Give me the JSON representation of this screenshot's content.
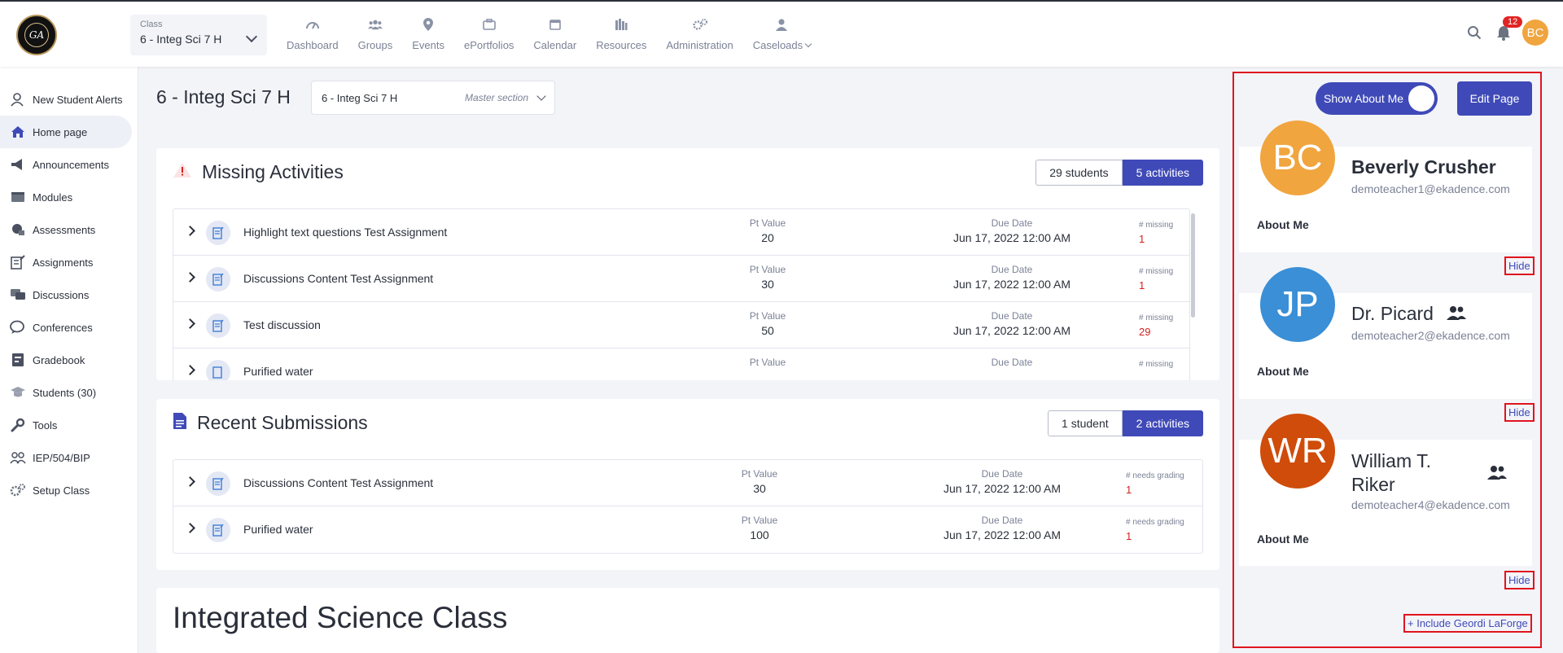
{
  "topbar": {
    "logo_text": "GA",
    "class_label": "Class",
    "class_value": "6 - Integ Sci 7 H",
    "nav": [
      {
        "label": "Dashboard",
        "icon": "gauge-icon"
      },
      {
        "label": "Groups",
        "icon": "groups-icon"
      },
      {
        "label": "Events",
        "icon": "map-pin-icon"
      },
      {
        "label": "ePortfolios",
        "icon": "briefcase-icon"
      },
      {
        "label": "Calendar",
        "icon": "calendar-icon"
      },
      {
        "label": "Resources",
        "icon": "books-icon"
      },
      {
        "label": "Administration",
        "icon": "gears-icon"
      },
      {
        "label": "Caseloads",
        "icon": "user-icon"
      }
    ],
    "notification_count": "12",
    "user_initials": "BC"
  },
  "sidebar": {
    "items": [
      {
        "label": "New Student Alerts",
        "icon": "user-alert-icon"
      },
      {
        "label": "Home page",
        "icon": "home-icon"
      },
      {
        "label": "Announcements",
        "icon": "megaphone-icon"
      },
      {
        "label": "Modules",
        "icon": "folder-icon"
      },
      {
        "label": "Assessments",
        "icon": "assessment-icon"
      },
      {
        "label": "Assignments",
        "icon": "assignment-icon"
      },
      {
        "label": "Discussions",
        "icon": "discussion-icon"
      },
      {
        "label": "Conferences",
        "icon": "chat-icon"
      },
      {
        "label": "Gradebook",
        "icon": "gradebook-icon"
      },
      {
        "label": "Students (30)",
        "icon": "students-icon"
      },
      {
        "label": "Tools",
        "icon": "wrench-icon"
      },
      {
        "label": "IEP/504/BIP",
        "icon": "people-icon"
      },
      {
        "label": "Setup Class",
        "icon": "gear-icon"
      }
    ]
  },
  "main": {
    "title": "6 - Integ Sci 7 H",
    "section_value": "6 - Integ Sci 7 H",
    "section_meta": "Master section",
    "missing": {
      "title": "Missing Activities",
      "toggle_students": "29 students",
      "toggle_activities": "5 activities",
      "pt_header": "Pt Value",
      "due_header": "Due Date",
      "count_header": "# missing",
      "rows": [
        {
          "name": "Highlight text questions Test Assignment",
          "pt": "20",
          "due": "Jun 17, 2022 12:00 AM",
          "count": "1"
        },
        {
          "name": "Discussions Content Test Assignment",
          "pt": "30",
          "due": "Jun 17, 2022 12:00 AM",
          "count": "1"
        },
        {
          "name": "Test discussion",
          "pt": "50",
          "due": "Jun 17, 2022 12:00 AM",
          "count": "29"
        },
        {
          "name": "Purified water",
          "pt": "",
          "due": "",
          "count": ""
        }
      ]
    },
    "recent": {
      "title": "Recent Submissions",
      "toggle_students": "1 student",
      "toggle_activities": "2 activities",
      "pt_header": "Pt Value",
      "due_header": "Due Date",
      "count_header": "# needs grading",
      "rows": [
        {
          "name": "Discussions Content Test Assignment",
          "pt": "30",
          "due": "Jun 17, 2022 12:00 AM",
          "count": "1"
        },
        {
          "name": "Purified water",
          "pt": "100",
          "due": "Jun 17, 2022 12:00 AM",
          "count": "1"
        }
      ]
    },
    "integrated_title": "Integrated Science Class"
  },
  "right": {
    "show_about_label": "Show About Me",
    "edit_page_label": "Edit Page",
    "teachers": [
      {
        "initials": "BC",
        "name": "Beverly Crusher",
        "email": "demoteacher1@ekadence.com",
        "about_label": "About Me",
        "hide_label": "Hide",
        "color": "#f0a53e"
      },
      {
        "initials": "JP",
        "name": "Dr. Picard",
        "email": "demoteacher2@ekadence.com",
        "about_label": "About Me",
        "hide_label": "Hide",
        "color": "#3a8fd6"
      },
      {
        "initials": "WR",
        "name_line1": "William T.",
        "name_line2": "Riker",
        "email": "demoteacher4@ekadence.com",
        "about_label": "About Me",
        "hide_label": "Hide",
        "color": "#cf4c0a"
      }
    ],
    "include_label": "+ Include Geordi LaForge"
  }
}
